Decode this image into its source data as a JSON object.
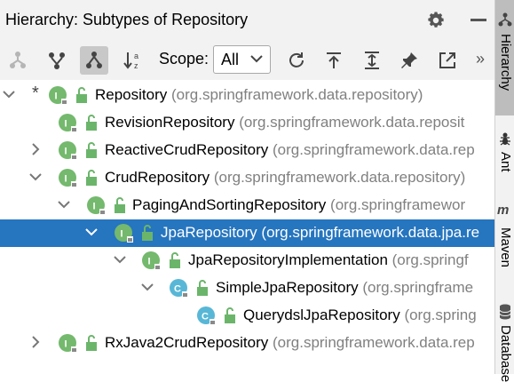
{
  "header": {
    "title": "Hierarchy:  Subtypes of Repository"
  },
  "toolbar": {
    "scope_label": "Scope:",
    "scope_value": "All",
    "more": "»"
  },
  "tree": {
    "rows": [
      {
        "name": "Repository",
        "package": "(org.springframework.data.repository)",
        "kind": "I",
        "arrow": "down",
        "star": "*"
      },
      {
        "name": "RevisionRepository",
        "package": "(org.springframework.data.reposit",
        "kind": "I",
        "arrow": ""
      },
      {
        "name": "ReactiveCrudRepository",
        "package": "(org.springframework.data.rep",
        "kind": "I",
        "arrow": "right"
      },
      {
        "name": "CrudRepository",
        "package": "(org.springframework.data.repository)",
        "kind": "I",
        "arrow": "down"
      },
      {
        "name": "PagingAndSortingRepository",
        "package": "(org.springframewor",
        "kind": "I",
        "arrow": "down"
      },
      {
        "name": "JpaRepository",
        "package": "(org.springframework.data.jpa.re",
        "kind": "I",
        "arrow": "down",
        "selected": true
      },
      {
        "name": "JpaRepositoryImplementation",
        "package": "(org.springf",
        "kind": "I",
        "arrow": "down"
      },
      {
        "name": "SimpleJpaRepository",
        "package": "(org.springframe",
        "kind": "C",
        "arrow": "down"
      },
      {
        "name": "QuerydslJpaRepository",
        "package": "(org.spring",
        "kind": "C",
        "arrow": ""
      },
      {
        "name": "RxJava2CrudRepository",
        "package": "(org.springframework.data.rep",
        "kind": "I",
        "arrow": "right"
      }
    ]
  },
  "sidebar": {
    "tabs": [
      "Hierarchy",
      "Ant",
      "Maven",
      "Database"
    ]
  },
  "colors": {
    "selection": "#2675bf",
    "interface": "#74b96d",
    "class": "#58b7d6",
    "panel": "#f2f2f2"
  }
}
